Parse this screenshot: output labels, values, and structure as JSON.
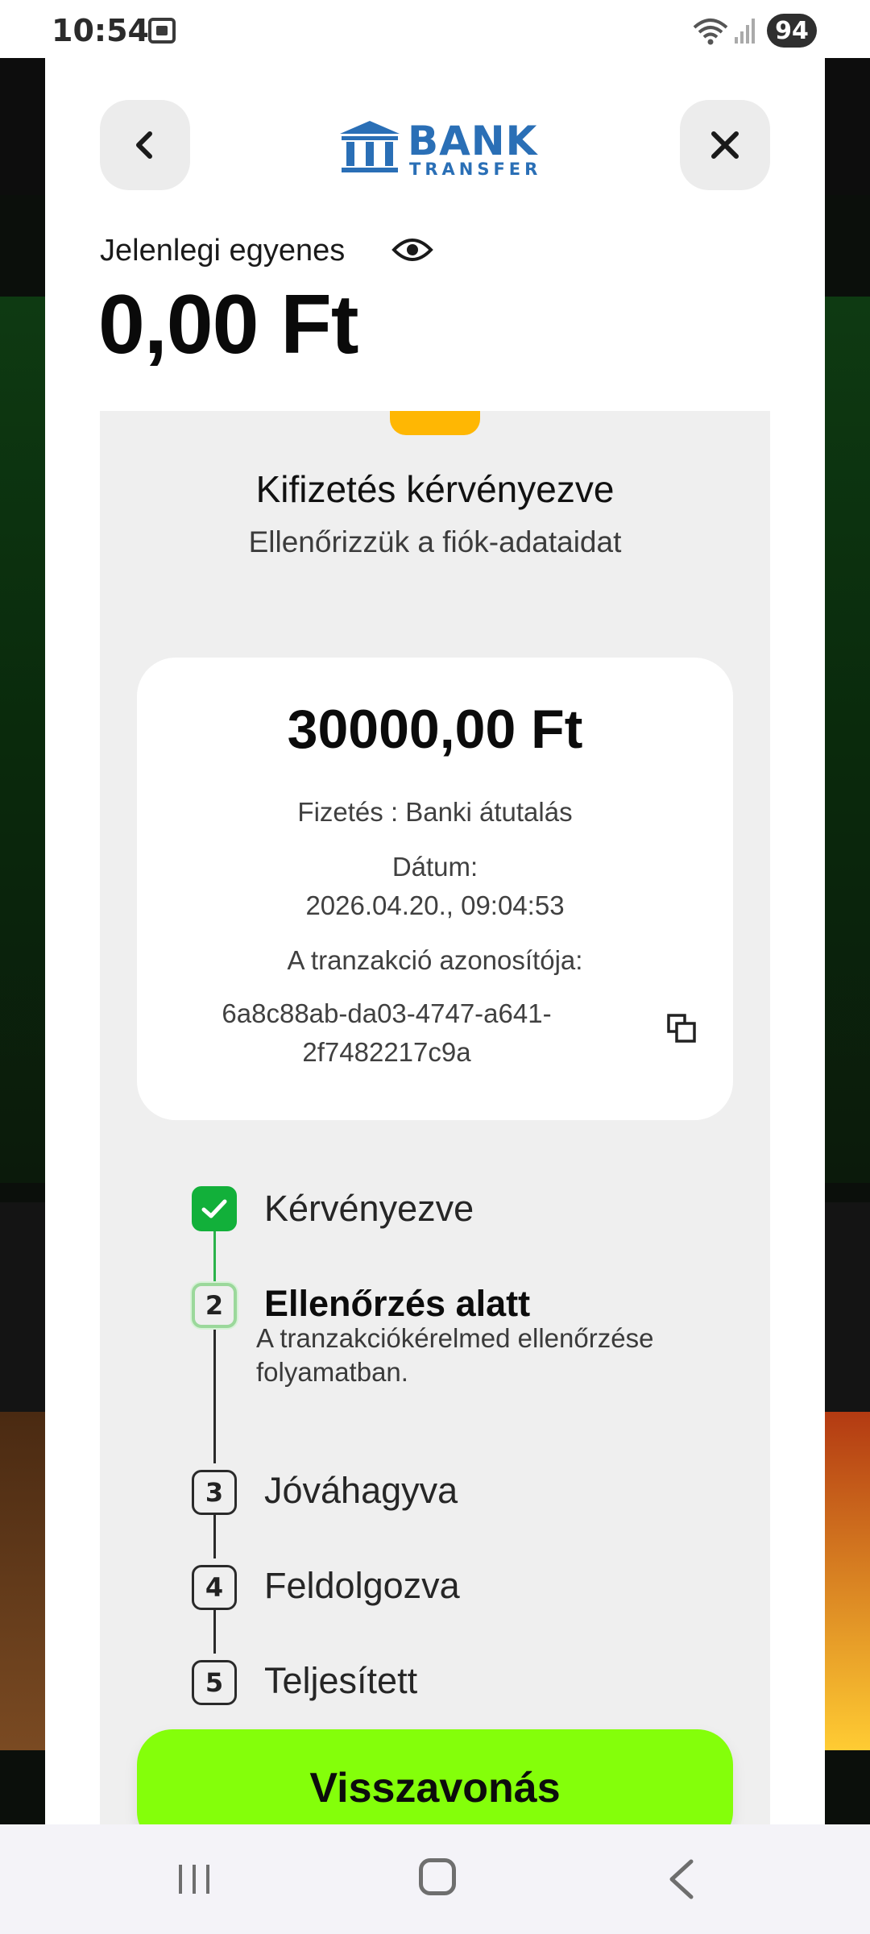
{
  "status_bar": {
    "time": "10:54",
    "battery": "94",
    "icons": [
      "gallery-icon",
      "wifi-icon",
      "signal-icon"
    ]
  },
  "header": {
    "logo_main": "BANK",
    "logo_sub": "TRANSFER",
    "back_icon": "chevron-left-icon",
    "close_icon": "close-icon"
  },
  "balance": {
    "label": "Jelenlegi egyenes",
    "value": "0,00 Ft"
  },
  "withdrawal": {
    "title": "Kifizetés kérvényezve",
    "subtitle": "Ellenőrizzük a fiók-adataidat",
    "amount": "30000,00 Ft",
    "payment": "Fizetés :  Banki átutalás",
    "date_label": "Dátum:",
    "date_value": "2026.04.20., 09:04:53",
    "txid_label": "A tranzakció azonosítója:",
    "txid_line1": "6a8c88ab-da03-4747-a641-",
    "txid_line2": "2f7482217c9a"
  },
  "steps": [
    {
      "number": "",
      "label": "Kérvényezve",
      "state": "done"
    },
    {
      "number": "2",
      "label": "Ellenőrzés alatt",
      "state": "active",
      "description": "A tranzakciókérelmed ellenőrzése folyamatban."
    },
    {
      "number": "3",
      "label": "Jóváhagyva",
      "state": "pending"
    },
    {
      "number": "4",
      "label": "Feldolgozva",
      "state": "pending"
    },
    {
      "number": "5",
      "label": "Teljesített",
      "state": "pending"
    }
  ],
  "actions": {
    "cancel_label": "Visszavonás"
  },
  "colors": {
    "accent_green": "#84ff0a",
    "step_done": "#12b03a",
    "logo_blue": "#2a6fb6",
    "tab_yellow": "#ffb703"
  }
}
